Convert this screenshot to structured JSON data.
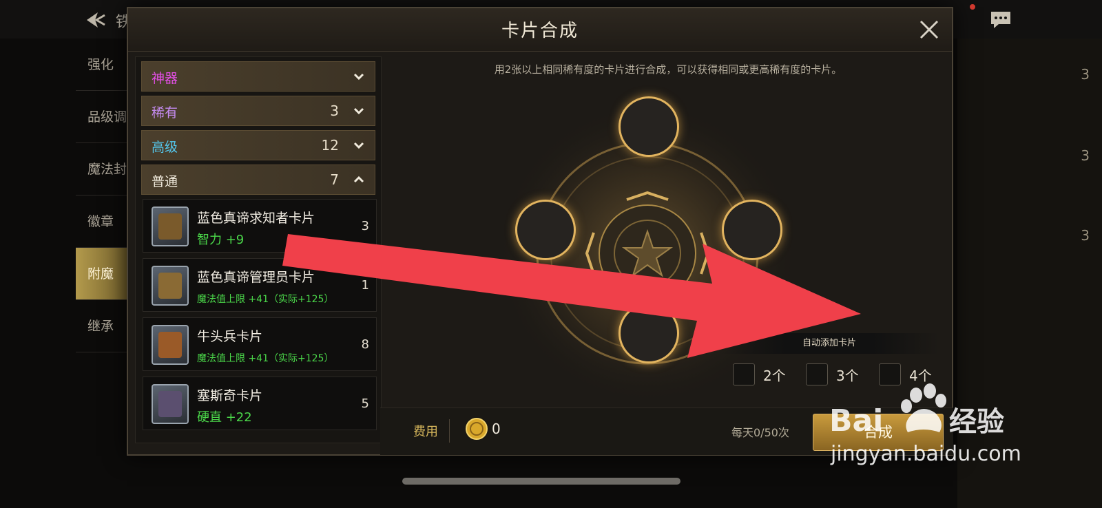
{
  "topbar": {
    "title": "铁"
  },
  "sidenav": {
    "items": [
      {
        "label": "强化",
        "active": false
      },
      {
        "label": "品级调",
        "active": false
      },
      {
        "label": "魔法封",
        "active": false
      },
      {
        "label": "徽章",
        "active": false
      },
      {
        "label": "附魔",
        "active": true
      },
      {
        "label": "继承",
        "active": false
      }
    ]
  },
  "background_list": {
    "counts": [
      "3",
      "3",
      "3"
    ]
  },
  "dialog": {
    "title": "卡片合成",
    "hint": "用2张以上相同稀有度的卡片进行合成，可以获得相同或更高稀有度的卡片。",
    "categories": [
      {
        "label": "神器",
        "count": "",
        "color": "#e34fe6",
        "expanded": false
      },
      {
        "label": "稀有",
        "count": "3",
        "color": "#c48bf0",
        "expanded": false
      },
      {
        "label": "高级",
        "count": "12",
        "color": "#54c7ec",
        "expanded": false
      },
      {
        "label": "普通",
        "count": "7",
        "color": "#f1ebdd",
        "expanded": true
      }
    ],
    "cards": [
      {
        "name": "蓝色真谛求知者卡片",
        "stat": "智力 +9",
        "count": "3",
        "thumb_color": "#7a5a2b"
      },
      {
        "name": "蓝色真谛管理员卡片",
        "stat": "魔法值上限 +41（实际+125）",
        "count": "1",
        "thumb_color": "#8a6a34"
      },
      {
        "name": "牛头兵卡片",
        "stat": "魔法值上限 +41（实际+125）",
        "count": "8",
        "thumb_color": "#9a5a28"
      },
      {
        "name": "塞斯奇卡片",
        "stat": "硬直 +22",
        "count": "5",
        "thumb_color": "#5b4f6f"
      }
    ],
    "auto_add": {
      "title": "自动添加卡片",
      "options": [
        "2个",
        "3个",
        "4个"
      ]
    },
    "footer": {
      "cost_label": "费用",
      "cost_value": "0",
      "daily_limit": "每天0/50次",
      "synth_button": "合成"
    }
  },
  "watermark": {
    "brand": "Bai du 经验",
    "url": "jingyan.baidu.com"
  },
  "colors": {
    "accent_gold": "#e2b45f",
    "arrow_red": "#f0404a",
    "stat_green": "#4bd84a"
  }
}
